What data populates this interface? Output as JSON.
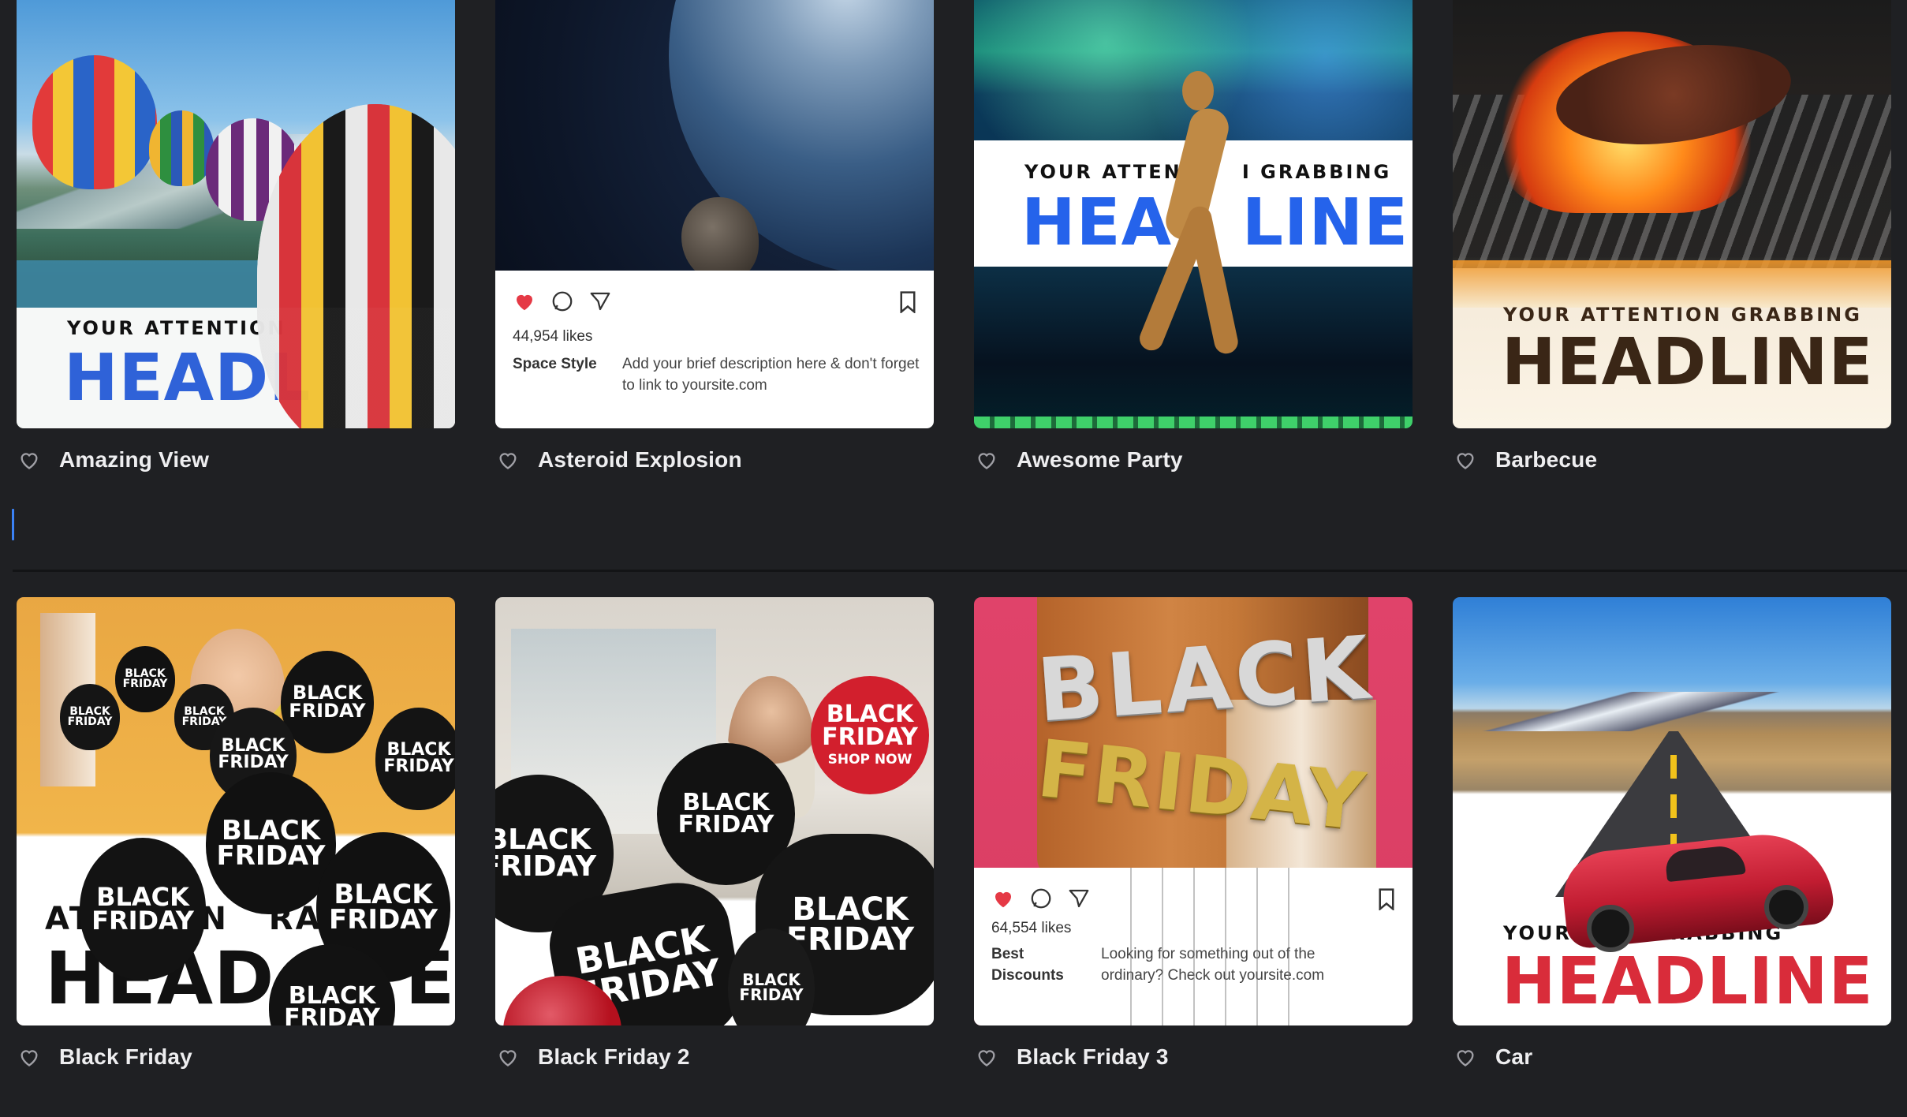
{
  "cards": [
    {
      "title": "Amazing View",
      "overlay_small": "YOUR ATTENTION",
      "overlay_big": "HEADL",
      "colors": {
        "headline": "#2f62d8"
      }
    },
    {
      "title": "Asteroid Explosion",
      "likes": "44,954 likes",
      "user": "Space Style",
      "description": "Add your brief description here & don't forget to link to yoursite.com"
    },
    {
      "title": "Awesome Party",
      "overlay_small": "YOUR ATTENT     I GRABBING",
      "overlay_big": "HEA   LINE",
      "colors": {
        "headline": "#2563eb"
      }
    },
    {
      "title": "Barbecue",
      "overlay_small": "YOUR ATTENTION GRABBING",
      "overlay_big": "HEADLINE",
      "colors": {
        "headline": "#3a2616"
      }
    },
    {
      "title": "Black Friday",
      "overlay_small": "AT        N   RA",
      "overlay_big": "HEAD     E",
      "balloon_text": "BLACK FRIDAY"
    },
    {
      "title": "Black Friday 2",
      "balloon_text": "BLACK FRIDAY",
      "shop_now": "SHOP NOW"
    },
    {
      "title": "Black Friday 3",
      "foil_word_1": "BLACK",
      "foil_word_2": "FRIDAY",
      "likes": "64,554 likes",
      "user": "Best Discounts",
      "description": "Looking for something out of the ordinary? Check out yoursite.com"
    },
    {
      "title": "Car",
      "overlay_small": "YOUR           RABBING",
      "overlay_big": "HEADLINE",
      "colors": {
        "headline": "#d92c3a"
      }
    }
  ],
  "icons": {
    "favorite": "heart-outline-icon",
    "like": "heart-filled-icon",
    "comment": "comment-icon",
    "share": "send-icon",
    "save": "bookmark-icon"
  },
  "colors": {
    "background": "#1f2023",
    "title_text": "#eeeef0",
    "heart_outline": "#a0a0a6",
    "like_red": "#e53945",
    "text_cursor": "#3b82f6"
  }
}
